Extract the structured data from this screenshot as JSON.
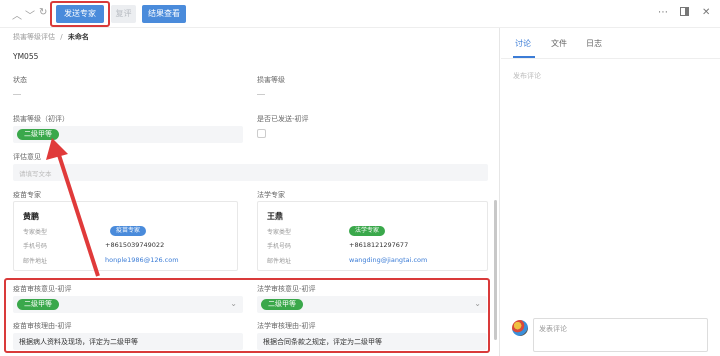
{
  "toolbar": {
    "send_expert": "发送专家",
    "review": "复评",
    "view_results": "结果查看",
    "more": "⋯"
  },
  "breadcrumb": {
    "parent": "损害等级评估",
    "sep": "/",
    "current": "未命名"
  },
  "record_id": "YM055",
  "form": {
    "status_label": "状态",
    "damage_level_label": "损害等级",
    "initial_level_label": "损害等级（初评）",
    "initial_level_value": "二级甲等",
    "sent_label": "是否已发送-初评",
    "opinion_label": "评估意见",
    "opinion_placeholder": "请填写文本",
    "vaccine_expert_label": "疫苗专家",
    "legal_expert_label": "法学专家",
    "vaccine_review_label": "疫苗审核意见-初评",
    "vaccine_review_value": "二级甲等",
    "legal_review_label": "法学审核意见-初评",
    "legal_review_value": "二级甲等",
    "vaccine_reason_label": "疫苗审核理由-初评",
    "vaccine_reason_value": "根据病人资料及现场，评定为二级甲等",
    "legal_reason_label": "法学审核理由-初评",
    "legal_reason_value": "根据合同条款之规定，评定为二级甲等"
  },
  "vaccine_card": {
    "name": "黄鹏",
    "type_label": "专家类型",
    "type_value": "疫苗专家",
    "phone_label": "手机号码",
    "phone_value": "+8615039749022",
    "email_label": "邮件地址",
    "email_value": "honple1986@126.com"
  },
  "legal_card": {
    "name": "王鼎",
    "type_label": "专家类型",
    "type_value": "法学专家",
    "phone_label": "手机号码",
    "phone_value": "+8618121297677",
    "email_label": "邮件地址",
    "email_value": "wangding@jiangtai.com"
  },
  "panel": {
    "tabs": [
      "讨论",
      "文件",
      "日志"
    ],
    "post_placeholder": "发布评论",
    "comment_placeholder": "发表评论"
  },
  "colors": {
    "primary": "#4a8bdb",
    "success_pill": "#3aa84b",
    "vaccine_badge": "#4a8bdb",
    "legal_badge": "#3aa84b",
    "highlight": "#d93a3a",
    "link": "#3b7cd6"
  }
}
